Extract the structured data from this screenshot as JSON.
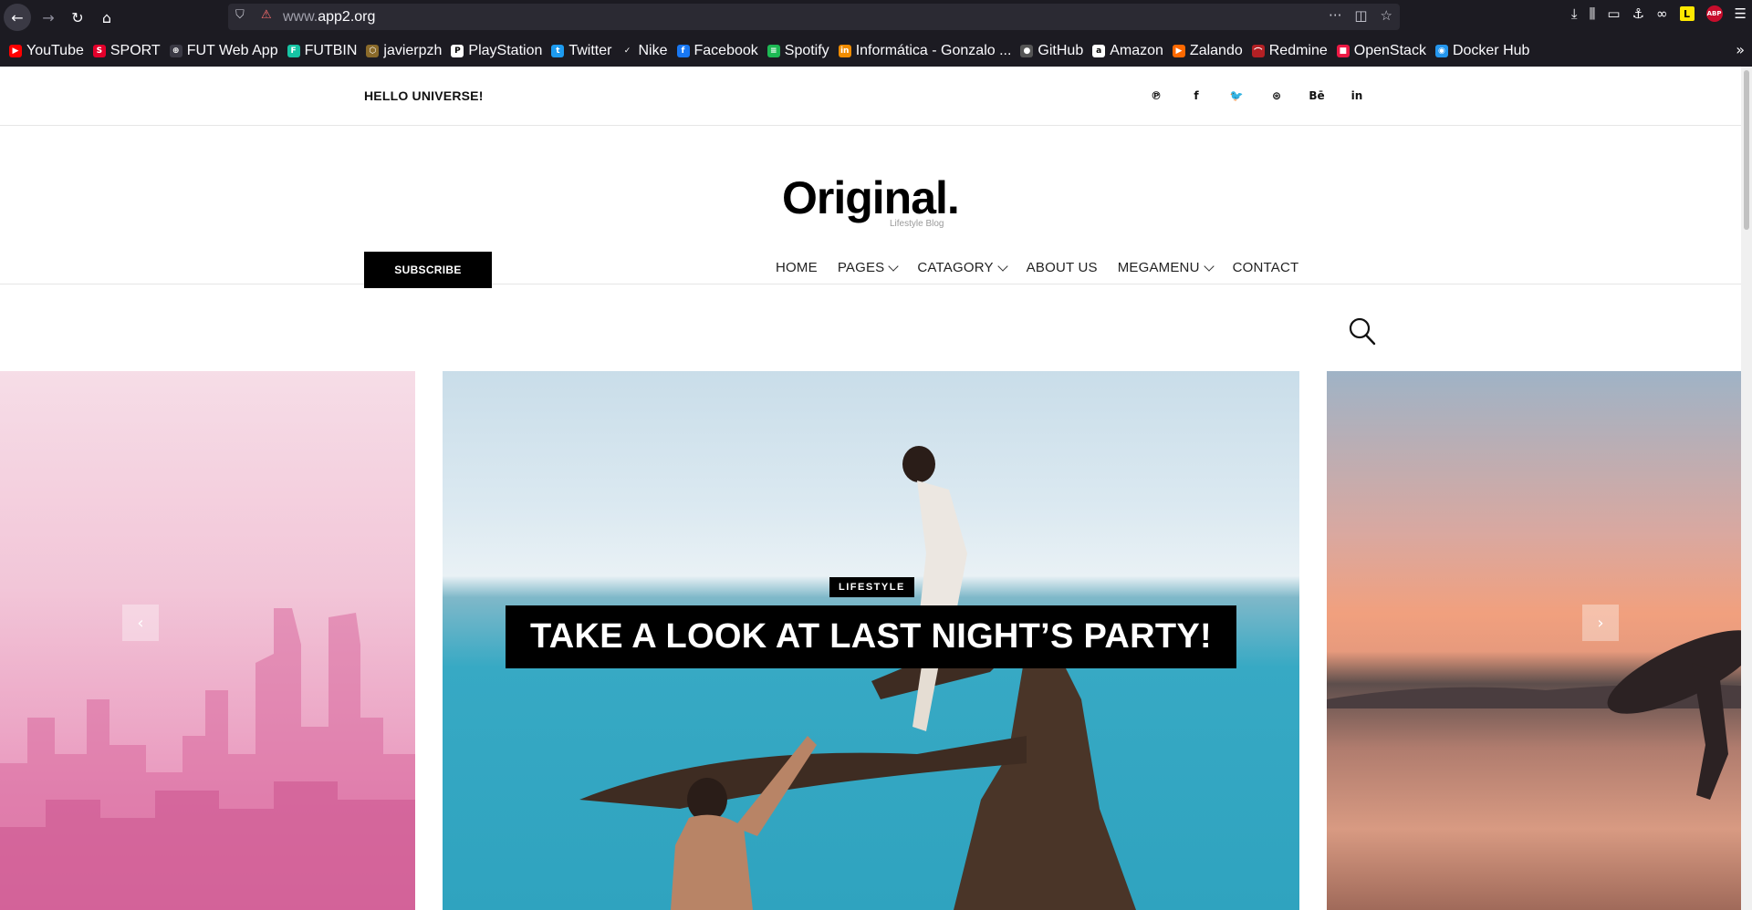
{
  "browser": {
    "url_prefix": "www.",
    "url_domain": "app2.org",
    "bookmarks": [
      {
        "label": "YouTube",
        "icon": "youtube-icon",
        "color": "#ff0000",
        "glyph": "▶"
      },
      {
        "label": "SPORT",
        "icon": "sport-icon",
        "color": "#e4002b",
        "glyph": "S"
      },
      {
        "label": "FUT Web App",
        "icon": "globe-icon",
        "color": "#3a3944",
        "glyph": "⊕"
      },
      {
        "label": "FUTBIN",
        "icon": "futbin-icon",
        "color": "#16c4a4",
        "glyph": "F"
      },
      {
        "label": "javierpzh",
        "icon": "javierpzh-icon",
        "color": "#8a6a2a",
        "glyph": "⬡"
      },
      {
        "label": "PlayStation",
        "icon": "playstation-icon",
        "color": "#ffffff",
        "glyph": "P"
      },
      {
        "label": "Twitter",
        "icon": "twitter-icon",
        "color": "#1d9bf0",
        "glyph": "t"
      },
      {
        "label": "Nike",
        "icon": "nike-icon",
        "color": "#1c1b22",
        "glyph": "✓"
      },
      {
        "label": "Facebook",
        "icon": "facebook-icon",
        "color": "#1877f2",
        "glyph": "f"
      },
      {
        "label": "Spotify",
        "icon": "spotify-icon",
        "color": "#1db954",
        "glyph": "≡"
      },
      {
        "label": "Informática - Gonzalo ...",
        "icon": "informatica-icon",
        "color": "#f08c00",
        "glyph": "in"
      },
      {
        "label": "GitHub",
        "icon": "github-icon",
        "color": "#555555",
        "glyph": "●"
      },
      {
        "label": "Amazon",
        "icon": "amazon-icon",
        "color": "#ffffff",
        "glyph": "a"
      },
      {
        "label": "Zalando",
        "icon": "zalando-icon",
        "color": "#ff6900",
        "glyph": "▶"
      },
      {
        "label": "Redmine",
        "icon": "redmine-icon",
        "color": "#b32024",
        "glyph": "⌒"
      },
      {
        "label": "OpenStack",
        "icon": "openstack-icon",
        "color": "#ed1944",
        "glyph": "■"
      },
      {
        "label": "Docker Hub",
        "icon": "docker-icon",
        "color": "#2496ed",
        "glyph": "◉"
      }
    ]
  },
  "site": {
    "greeting": "HELLO UNIVERSE!",
    "social": [
      {
        "icon": "pinterest-icon",
        "glyph": "℗"
      },
      {
        "icon": "facebook-icon",
        "glyph": "f"
      },
      {
        "icon": "twitter-icon",
        "glyph": "🐦"
      },
      {
        "icon": "dribbble-icon",
        "glyph": "⊛"
      },
      {
        "icon": "behance-icon",
        "glyph": "Bē"
      },
      {
        "icon": "linkedin-icon",
        "glyph": "in"
      }
    ],
    "logo": "Original.",
    "tagline": "Lifestyle Blog",
    "subscribe_label": "SUBSCRIBE",
    "nav": [
      {
        "label": "HOME",
        "dropdown": false
      },
      {
        "label": "PAGES",
        "dropdown": true
      },
      {
        "label": "CATAGORY",
        "dropdown": true
      },
      {
        "label": "ABOUT US",
        "dropdown": false
      },
      {
        "label": "MEGAMENU",
        "dropdown": true
      },
      {
        "label": "CONTACT",
        "dropdown": false
      }
    ]
  },
  "slider": {
    "category": "LIFESTYLE",
    "title": "TAKE A LOOK AT LAST NIGHT’S PARTY!",
    "prev_glyph": "‹",
    "next_glyph": "›"
  }
}
